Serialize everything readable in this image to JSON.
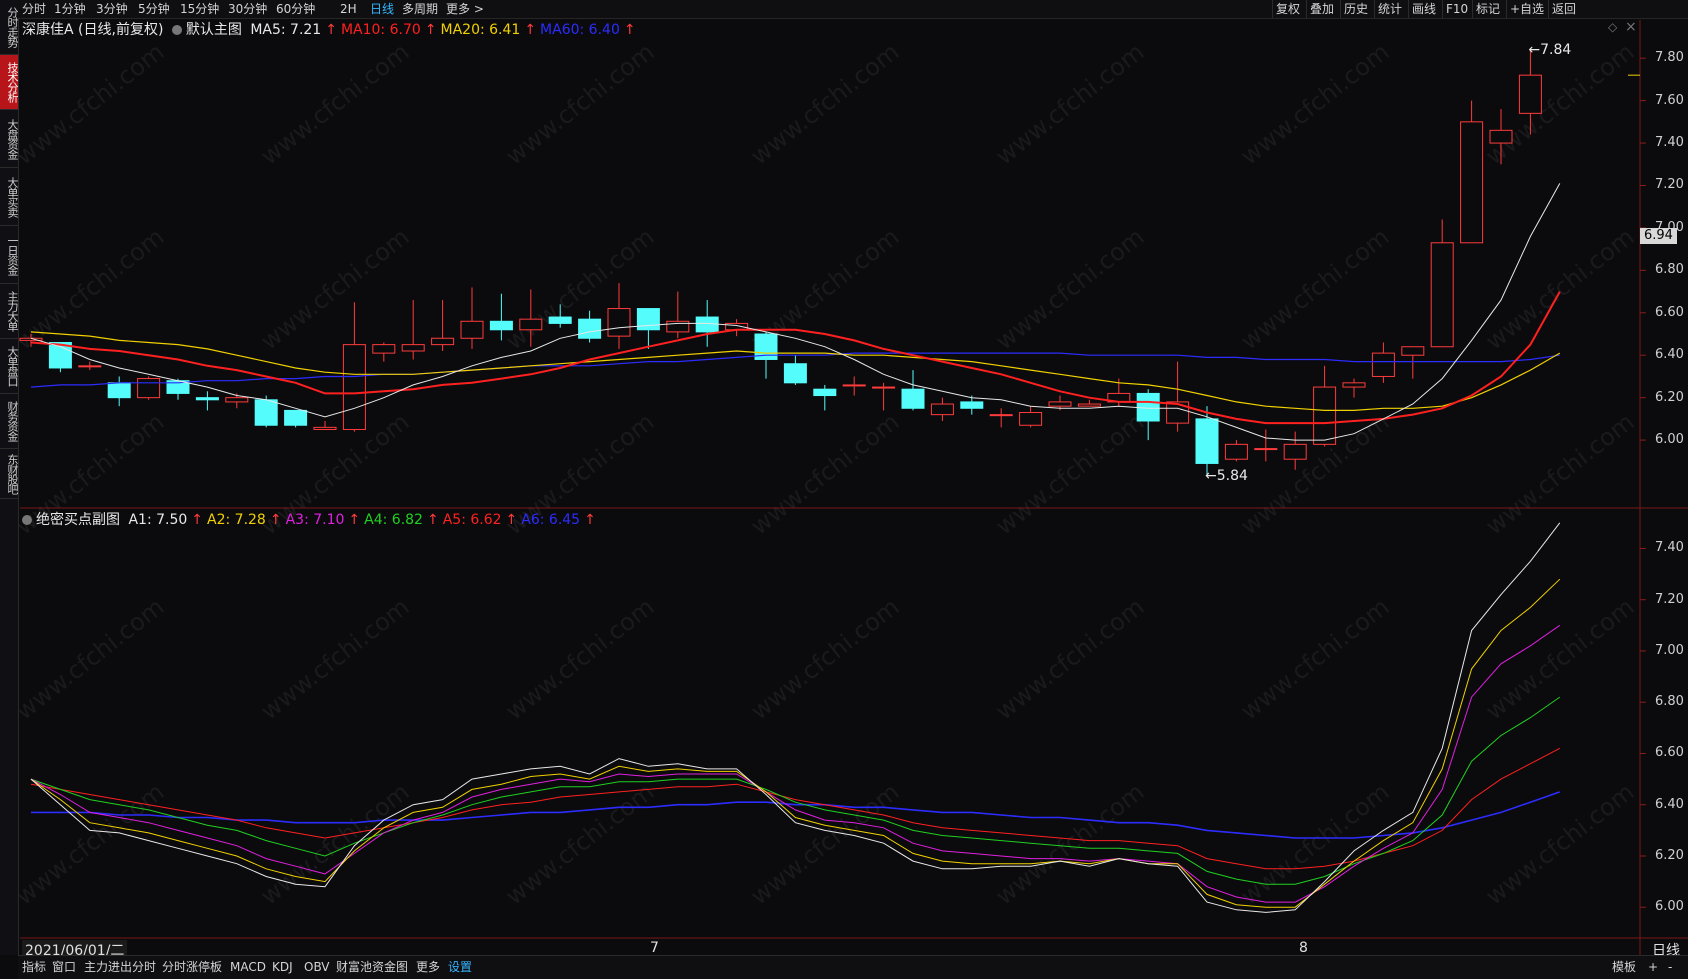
{
  "left_tabs": [
    {
      "label": "分时走势",
      "active": false
    },
    {
      "label": "技术分析",
      "active": true
    },
    {
      "label": "大盘资金",
      "active": false
    },
    {
      "label": "大单买卖",
      "active": false
    },
    {
      "label": "一日资金",
      "active": false
    },
    {
      "label": "主力大单",
      "active": false
    },
    {
      "label": "大单盘口",
      "active": false
    },
    {
      "label": "财务资金",
      "active": false
    },
    {
      "label": "东财股吧",
      "active": false
    }
  ],
  "period_tabs": [
    "分时",
    "1分钟",
    "3分钟",
    "5分钟",
    "15分钟",
    "30分钟",
    "60分钟",
    "2H",
    "日线",
    "多周期",
    "更多"
  ],
  "selected_period": "日线",
  "right_tools": [
    "复权",
    "叠加",
    "历史",
    "统计",
    "画线",
    "F10",
    "标记",
    "+自选",
    "返回"
  ],
  "main_info": {
    "stock": "深康佳A (日线,前复权)",
    "indicator": "默认主图",
    "ma": [
      {
        "label": "MA5: 7.21",
        "color": "#e8e8e8"
      },
      {
        "label": "MA10: 6.70",
        "color": "#ff2020"
      },
      {
        "label": "MA20: 6.41",
        "color": "#f0d000"
      },
      {
        "label": "MA60: 6.40",
        "color": "#2c2cff"
      }
    ]
  },
  "sub_info": {
    "indicator": "绝密买点副图",
    "lines": [
      {
        "label": "A1: 7.50",
        "color": "#e8e8e8"
      },
      {
        "label": "A2: 7.28",
        "color": "#f0d000"
      },
      {
        "label": "A3: 7.10",
        "color": "#e020e0"
      },
      {
        "label": "A4: 6.82",
        "color": "#20d020"
      },
      {
        "label": "A5: 6.62",
        "color": "#ff2020"
      },
      {
        "label": "A6: 6.45",
        "color": "#2c2cff"
      }
    ]
  },
  "up_arrow": "↑",
  "main_axis": [
    "7.80",
    "7.60",
    "7.40",
    "7.20",
    "7.00",
    "6.80",
    "6.60",
    "6.40",
    "6.20",
    "6.00"
  ],
  "sub_axis": [
    "7.40",
    "7.20",
    "7.00",
    "6.80",
    "6.60",
    "6.40",
    "6.20",
    "6.00"
  ],
  "current_price": "6.94",
  "high_label": "7.84",
  "low_label": "5.84",
  "date_labels": {
    "start": "2021/06/01/二",
    "m7": "7",
    "m8": "8"
  },
  "period_badge": "日线",
  "bottom_tabs": [
    "指标",
    "窗口",
    "主力进出分时",
    "分时涨停板",
    "MACD",
    "KDJ",
    "OBV",
    "财富池资金图",
    "更多",
    "设置"
  ],
  "bottom_right": {
    "template": "模板",
    "add": "+",
    "sub": "-"
  },
  "watermark": "www.cfchi.com",
  "chart_data": {
    "type": "candlestick",
    "candles": [
      {
        "o": 6.47,
        "h": 6.5,
        "l": 6.44,
        "c": 6.48
      },
      {
        "o": 6.46,
        "h": 6.46,
        "l": 6.32,
        "c": 6.34
      },
      {
        "o": 6.35,
        "h": 6.37,
        "l": 6.33,
        "c": 6.35
      },
      {
        "o": 6.27,
        "h": 6.3,
        "l": 6.16,
        "c": 6.2
      },
      {
        "o": 6.2,
        "h": 6.3,
        "l": 6.19,
        "c": 6.29
      },
      {
        "o": 6.28,
        "h": 6.29,
        "l": 6.19,
        "c": 6.22
      },
      {
        "o": 6.2,
        "h": 6.23,
        "l": 6.14,
        "c": 6.19
      },
      {
        "o": 6.18,
        "h": 6.22,
        "l": 6.15,
        "c": 6.2
      },
      {
        "o": 6.19,
        "h": 6.21,
        "l": 6.06,
        "c": 6.07
      },
      {
        "o": 6.14,
        "h": 6.14,
        "l": 6.06,
        "c": 6.07
      },
      {
        "o": 6.05,
        "h": 6.09,
        "l": 6.05,
        "c": 6.06
      },
      {
        "o": 6.05,
        "h": 6.65,
        "l": 6.04,
        "c": 6.45
      },
      {
        "o": 6.41,
        "h": 6.46,
        "l": 6.37,
        "c": 6.45
      },
      {
        "o": 6.42,
        "h": 6.66,
        "l": 6.38,
        "c": 6.45
      },
      {
        "o": 6.45,
        "h": 6.66,
        "l": 6.42,
        "c": 6.48
      },
      {
        "o": 6.48,
        "h": 6.72,
        "l": 6.43,
        "c": 6.56
      },
      {
        "o": 6.56,
        "h": 6.69,
        "l": 6.47,
        "c": 6.52
      },
      {
        "o": 6.52,
        "h": 6.71,
        "l": 6.44,
        "c": 6.57
      },
      {
        "o": 6.58,
        "h": 6.64,
        "l": 6.53,
        "c": 6.55
      },
      {
        "o": 6.57,
        "h": 6.61,
        "l": 6.46,
        "c": 6.48
      },
      {
        "o": 6.49,
        "h": 6.74,
        "l": 6.43,
        "c": 6.62
      },
      {
        "o": 6.62,
        "h": 6.62,
        "l": 6.43,
        "c": 6.52
      },
      {
        "o": 6.51,
        "h": 6.7,
        "l": 6.48,
        "c": 6.56
      },
      {
        "o": 6.58,
        "h": 6.66,
        "l": 6.44,
        "c": 6.51
      },
      {
        "o": 6.52,
        "h": 6.57,
        "l": 6.49,
        "c": 6.55
      },
      {
        "o": 6.5,
        "h": 6.51,
        "l": 6.29,
        "c": 6.38
      },
      {
        "o": 6.36,
        "h": 6.4,
        "l": 6.26,
        "c": 6.27
      },
      {
        "o": 6.24,
        "h": 6.26,
        "l": 6.14,
        "c": 6.21
      },
      {
        "o": 6.26,
        "h": 6.3,
        "l": 6.21,
        "c": 6.26
      },
      {
        "o": 6.25,
        "h": 6.27,
        "l": 6.14,
        "c": 6.25
      },
      {
        "o": 6.24,
        "h": 6.33,
        "l": 6.14,
        "c": 6.15
      },
      {
        "o": 6.12,
        "h": 6.2,
        "l": 6.09,
        "c": 6.17
      },
      {
        "o": 6.18,
        "h": 6.21,
        "l": 6.12,
        "c": 6.15
      },
      {
        "o": 6.12,
        "h": 6.15,
        "l": 6.06,
        "c": 6.12
      },
      {
        "o": 6.07,
        "h": 6.16,
        "l": 6.06,
        "c": 6.13
      },
      {
        "o": 6.16,
        "h": 6.21,
        "l": 6.14,
        "c": 6.18
      },
      {
        "o": 6.16,
        "h": 6.19,
        "l": 6.16,
        "c": 6.17
      },
      {
        "o": 6.18,
        "h": 6.29,
        "l": 6.16,
        "c": 6.22
      },
      {
        "o": 6.22,
        "h": 6.24,
        "l": 6.0,
        "c": 6.09
      },
      {
        "o": 6.08,
        "h": 6.37,
        "l": 6.04,
        "c": 6.18
      },
      {
        "o": 6.1,
        "h": 6.16,
        "l": 5.84,
        "c": 5.89
      },
      {
        "o": 5.91,
        "h": 6.0,
        "l": 5.9,
        "c": 5.98
      },
      {
        "o": 5.96,
        "h": 6.05,
        "l": 5.9,
        "c": 5.96
      },
      {
        "o": 5.91,
        "h": 6.04,
        "l": 5.86,
        "c": 5.98
      },
      {
        "o": 5.98,
        "h": 6.35,
        "l": 5.97,
        "c": 6.25
      },
      {
        "o": 6.25,
        "h": 6.29,
        "l": 6.2,
        "c": 6.27
      },
      {
        "o": 6.3,
        "h": 6.46,
        "l": 6.27,
        "c": 6.41
      },
      {
        "o": 6.4,
        "h": 6.43,
        "l": 6.29,
        "c": 6.44
      },
      {
        "o": 6.44,
        "h": 7.04,
        "l": 6.44,
        "c": 6.93
      },
      {
        "o": 6.93,
        "h": 7.6,
        "l": 6.93,
        "c": 7.5
      },
      {
        "o": 7.4,
        "h": 7.56,
        "l": 7.3,
        "c": 7.46
      },
      {
        "o": 7.54,
        "h": 7.84,
        "l": 7.44,
        "c": 7.72
      }
    ],
    "ma5": [
      6.48,
      6.44,
      6.38,
      6.34,
      6.31,
      6.28,
      6.25,
      6.21,
      6.19,
      6.15,
      6.11,
      6.15,
      6.2,
      6.26,
      6.3,
      6.35,
      6.39,
      6.42,
      6.48,
      6.51,
      6.53,
      6.54,
      6.55,
      6.55,
      6.54,
      6.51,
      6.48,
      6.44,
      6.38,
      6.31,
      6.26,
      6.23,
      6.2,
      6.19,
      6.16,
      6.15,
      6.15,
      6.16,
      6.15,
      6.15,
      6.11,
      6.06,
      6.01,
      6.0,
      6.0,
      6.03,
      6.1,
      6.17,
      6.29,
      6.47,
      6.66,
      6.96,
      7.21
    ],
    "ma10": [
      6.46,
      6.45,
      6.43,
      6.42,
      6.4,
      6.38,
      6.35,
      6.33,
      6.3,
      6.27,
      6.22,
      6.22,
      6.23,
      6.24,
      6.26,
      6.27,
      6.29,
      6.31,
      6.34,
      6.38,
      6.41,
      6.44,
      6.47,
      6.5,
      6.52,
      6.52,
      6.52,
      6.5,
      6.47,
      6.43,
      6.4,
      6.37,
      6.34,
      6.31,
      6.27,
      6.23,
      6.2,
      6.18,
      6.18,
      6.17,
      6.13,
      6.1,
      6.08,
      6.08,
      6.08,
      6.09,
      6.1,
      6.12,
      6.15,
      6.21,
      6.3,
      6.45,
      6.7
    ],
    "ma20": [
      6.51,
      6.5,
      6.49,
      6.47,
      6.46,
      6.45,
      6.43,
      6.4,
      6.37,
      6.34,
      6.32,
      6.31,
      6.31,
      6.31,
      6.32,
      6.33,
      6.34,
      6.35,
      6.36,
      6.37,
      6.38,
      6.39,
      6.4,
      6.41,
      6.42,
      6.41,
      6.41,
      6.41,
      6.4,
      6.4,
      6.39,
      6.38,
      6.37,
      6.35,
      6.33,
      6.31,
      6.29,
      6.27,
      6.26,
      6.24,
      6.21,
      6.18,
      6.16,
      6.15,
      6.14,
      6.14,
      6.15,
      6.15,
      6.16,
      6.2,
      6.26,
      6.33,
      6.41
    ],
    "ma60": [
      6.25,
      6.26,
      6.26,
      6.27,
      6.27,
      6.27,
      6.28,
      6.28,
      6.29,
      6.29,
      6.3,
      6.3,
      6.31,
      6.31,
      6.32,
      6.33,
      6.34,
      6.35,
      6.35,
      6.35,
      6.36,
      6.37,
      6.37,
      6.38,
      6.39,
      6.4,
      6.4,
      6.4,
      6.41,
      6.41,
      6.41,
      6.41,
      6.41,
      6.41,
      6.41,
      6.41,
      6.4,
      6.4,
      6.4,
      6.4,
      6.39,
      6.39,
      6.38,
      6.38,
      6.38,
      6.37,
      6.37,
      6.37,
      6.37,
      6.37,
      6.37,
      6.38,
      6.4
    ],
    "sub_lines": {
      "A1": [
        6.5,
        6.4,
        6.3,
        6.29,
        6.26,
        6.23,
        6.2,
        6.17,
        6.12,
        6.09,
        6.08,
        6.24,
        6.34,
        6.4,
        6.42,
        6.5,
        6.52,
        6.54,
        6.55,
        6.52,
        6.58,
        6.55,
        6.56,
        6.54,
        6.54,
        6.44,
        6.33,
        6.3,
        6.28,
        6.25,
        6.18,
        6.15,
        6.15,
        6.16,
        6.16,
        6.18,
        6.16,
        6.19,
        6.17,
        6.16,
        6.02,
        5.99,
        5.98,
        5.99,
        6.1,
        6.22,
        6.3,
        6.37,
        6.62,
        7.08,
        7.22,
        7.35,
        7.5
      ],
      "A2": [
        6.5,
        6.42,
        6.33,
        6.31,
        6.29,
        6.26,
        6.23,
        6.2,
        6.15,
        6.12,
        6.1,
        6.22,
        6.31,
        6.37,
        6.39,
        6.46,
        6.48,
        6.51,
        6.52,
        6.5,
        6.55,
        6.53,
        6.54,
        6.53,
        6.53,
        6.45,
        6.35,
        6.32,
        6.3,
        6.28,
        6.21,
        6.18,
        6.17,
        6.17,
        6.17,
        6.18,
        6.17,
        6.19,
        6.17,
        6.17,
        6.05,
        6.01,
        6.0,
        6.0,
        6.09,
        6.18,
        6.26,
        6.33,
        6.54,
        6.93,
        7.08,
        7.17,
        7.28
      ],
      "A3": [
        6.5,
        6.44,
        6.37,
        6.35,
        6.33,
        6.3,
        6.27,
        6.24,
        6.19,
        6.16,
        6.13,
        6.21,
        6.29,
        6.34,
        6.37,
        6.43,
        6.46,
        6.48,
        6.5,
        6.49,
        6.52,
        6.51,
        6.52,
        6.52,
        6.52,
        6.45,
        6.38,
        6.34,
        6.33,
        6.31,
        6.25,
        6.22,
        6.21,
        6.2,
        6.19,
        6.19,
        6.18,
        6.19,
        6.18,
        6.17,
        6.08,
        6.04,
        6.02,
        6.02,
        6.08,
        6.16,
        6.23,
        6.29,
        6.46,
        6.82,
        6.95,
        7.02,
        7.1
      ],
      "A4": [
        6.5,
        6.46,
        6.42,
        6.4,
        6.38,
        6.35,
        6.32,
        6.3,
        6.26,
        6.23,
        6.2,
        6.25,
        6.29,
        6.33,
        6.36,
        6.4,
        6.43,
        6.45,
        6.47,
        6.47,
        6.49,
        6.49,
        6.5,
        6.5,
        6.5,
        6.46,
        6.41,
        6.38,
        6.36,
        6.34,
        6.3,
        6.28,
        6.27,
        6.26,
        6.25,
        6.24,
        6.23,
        6.23,
        6.22,
        6.21,
        6.14,
        6.11,
        6.09,
        6.09,
        6.12,
        6.17,
        6.21,
        6.26,
        6.36,
        6.57,
        6.67,
        6.74,
        6.82
      ],
      "A5": [
        6.48,
        6.46,
        6.44,
        6.42,
        6.4,
        6.38,
        6.36,
        6.34,
        6.31,
        6.29,
        6.27,
        6.29,
        6.31,
        6.33,
        6.35,
        6.38,
        6.4,
        6.41,
        6.43,
        6.44,
        6.45,
        6.46,
        6.47,
        6.47,
        6.48,
        6.45,
        6.42,
        6.4,
        6.38,
        6.36,
        6.33,
        6.31,
        6.3,
        6.29,
        6.28,
        6.27,
        6.26,
        6.26,
        6.25,
        6.24,
        6.19,
        6.17,
        6.15,
        6.15,
        6.16,
        6.18,
        6.21,
        6.24,
        6.3,
        6.42,
        6.5,
        6.56,
        6.62
      ],
      "A6": [
        6.37,
        6.37,
        6.37,
        6.36,
        6.36,
        6.35,
        6.35,
        6.34,
        6.34,
        6.33,
        6.33,
        6.33,
        6.34,
        6.34,
        6.34,
        6.35,
        6.36,
        6.37,
        6.37,
        6.38,
        6.39,
        6.39,
        6.4,
        6.4,
        6.41,
        6.41,
        6.4,
        6.4,
        6.39,
        6.39,
        6.38,
        6.37,
        6.37,
        6.36,
        6.35,
        6.35,
        6.34,
        6.33,
        6.33,
        6.32,
        6.3,
        6.29,
        6.28,
        6.27,
        6.27,
        6.27,
        6.28,
        6.29,
        6.31,
        6.34,
        6.37,
        6.41,
        6.45
      ]
    },
    "main_ylim": [
      5.68,
      7.98
    ],
    "sub_ylim": [
      5.88,
      7.55
    ],
    "colors": {
      "up": "#ff3b3b",
      "down": "#54fcfc",
      "ma5": "#e8e8e8",
      "ma10": "#ff2020",
      "ma20": "#f0d000",
      "ma60": "#2c2cff"
    }
  }
}
